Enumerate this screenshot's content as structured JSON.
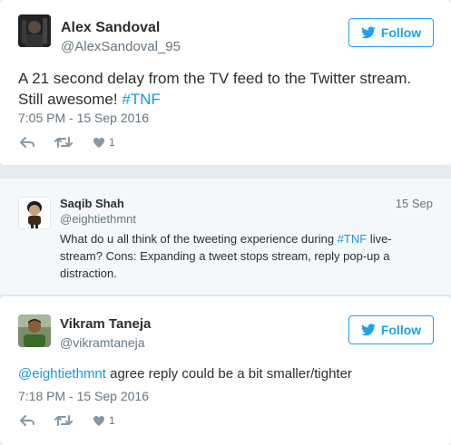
{
  "tweets": [
    {
      "name": "Alex Sandoval",
      "handle": "@AlexSandoval_95",
      "follow_label": "Follow",
      "text_plain": "A 21 second delay from the TV feed to the Twitter stream. Still awesome! ",
      "hashtag": "#TNF",
      "timestamp": "7:05 PM - 15 Sep 2016",
      "like_count": "1"
    },
    {
      "name": "Saqib Shah",
      "handle": "@eightiethmnt",
      "date": "15 Sep",
      "text_before": "What do u all think of the tweeting experience during ",
      "hashtag": "#TNF",
      "text_after": " live-stream? Cons: Expanding a tweet stops stream, reply pop-up a distraction."
    },
    {
      "name": "Vikram Taneja",
      "handle": "@vikramtaneja",
      "follow_label": "Follow",
      "mention": "@eightiethmnt",
      "text_after": " agree reply could be a bit smaller/tighter",
      "timestamp": "7:18 PM - 15 Sep 2016",
      "like_count": "1"
    }
  ],
  "colors": {
    "link": "#1b95e0",
    "follow_blue": "#1da1f2",
    "action_gray": "#8899a6"
  },
  "icons": [
    "twitter-bird-icon",
    "reply-icon",
    "retweet-icon",
    "like-heart-icon"
  ]
}
